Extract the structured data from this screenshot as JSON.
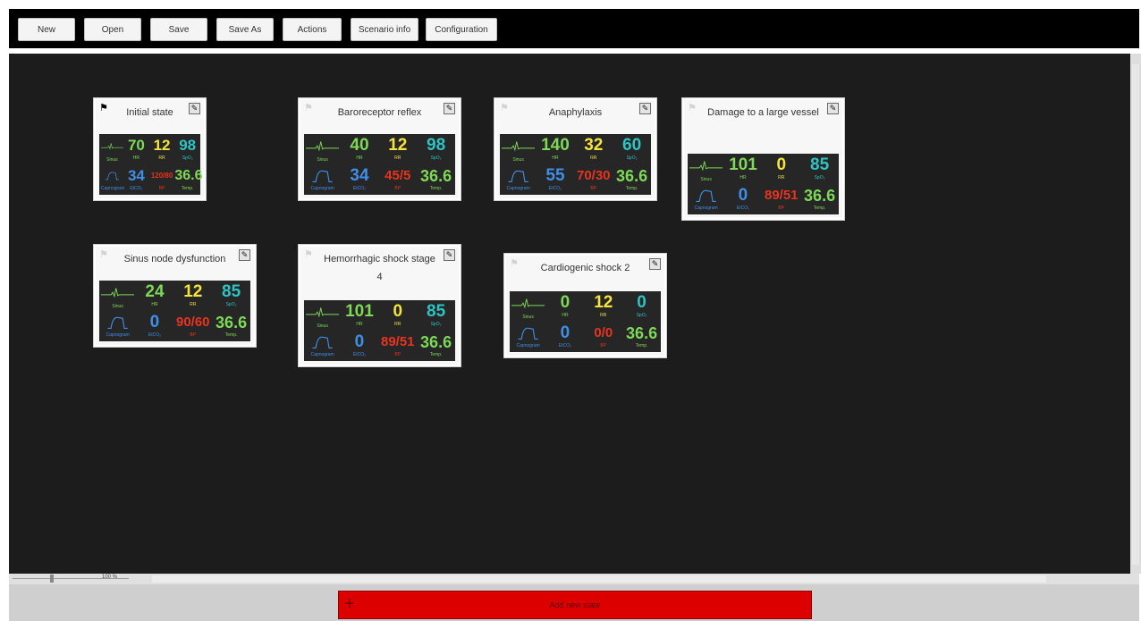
{
  "toolbar": {
    "buttons": [
      "New",
      "Open",
      "Save",
      "Save As",
      "Actions",
      "Scenario info",
      "Configuration"
    ]
  },
  "colors": {
    "hr": "#7ed957",
    "rr": "#f6e43c",
    "spo2": "#2ec4c4",
    "etco2": "#3f8fe8",
    "bp": "#e8341f",
    "temp": "#7ed957",
    "canvas": "#1c1c1c",
    "add_button": "#dd0000"
  },
  "labels": {
    "sinus": "Sinus",
    "capnogram": "Capnogram",
    "hr": "HR",
    "rr": "RR",
    "spo2": "SpO₂",
    "etco2": "EtCO₂",
    "bp": "BP",
    "temp": "Temp."
  },
  "states": [
    {
      "title": "Initial state",
      "active": true,
      "hr": "70",
      "rr": "12",
      "spo2": "98",
      "etco2": "34",
      "bp": "120/80",
      "temp": "36.6"
    },
    {
      "title": "Baroreceptor reflex",
      "active": false,
      "hr": "40",
      "rr": "12",
      "spo2": "98",
      "etco2": "34",
      "bp": "45/5",
      "temp": "36.6"
    },
    {
      "title": "Anaphylaxis",
      "active": false,
      "hr": "140",
      "rr": "32",
      "spo2": "60",
      "etco2": "55",
      "bp": "70/30",
      "temp": "36.6"
    },
    {
      "title": "Damage to a large vessel",
      "active": false,
      "hr": "101",
      "rr": "0",
      "spo2": "85",
      "etco2": "0",
      "bp": "89/51",
      "temp": "36.6"
    },
    {
      "title": "Sinus node dysfunction",
      "active": false,
      "hr": "24",
      "rr": "12",
      "spo2": "85",
      "etco2": "0",
      "bp": "90/60",
      "temp": "36.6"
    },
    {
      "title": "Hemorrhagic shock stage 4",
      "active": false,
      "hr": "101",
      "rr": "0",
      "spo2": "85",
      "etco2": "0",
      "bp": "89/51",
      "temp": "36.6"
    },
    {
      "title": "Cardiogenic shock 2",
      "active": false,
      "hr": "0",
      "rr": "12",
      "spo2": "0",
      "etco2": "0",
      "bp": "0/0",
      "temp": "36.6"
    }
  ],
  "zoom": "100 %",
  "add_state_label": "Add new state",
  "icons": {
    "flag": "flag-icon",
    "edit": "edit-pencil-icon",
    "plus": "plus-icon",
    "ecg": "ecg-wave-icon",
    "capno": "capnogram-wave-icon"
  }
}
